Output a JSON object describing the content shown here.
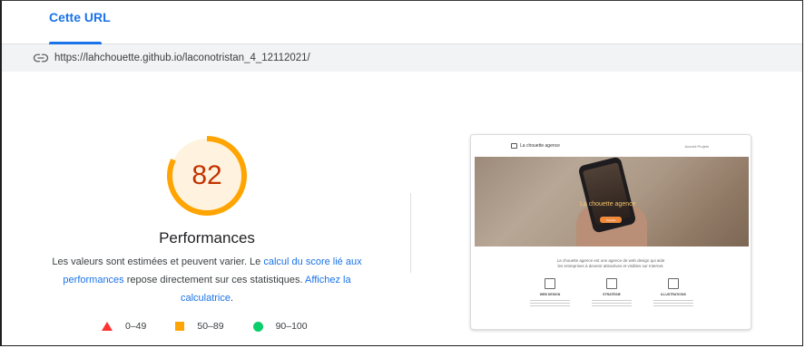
{
  "tabs": [
    {
      "label": "Cette URL",
      "active": true
    }
  ],
  "url": {
    "icon": "link-icon",
    "text": "https://lahchouette.github.io/laconotristan_4_12112021/"
  },
  "score": {
    "value": 82,
    "category": "Performances",
    "gauge_color": "#ffa400",
    "value_color": "#c33300",
    "fill_fraction": 0.82
  },
  "description": {
    "text_before": "Les valeurs sont estimées et peuvent varier. Le ",
    "link1": "calcul du score lié aux performances",
    "text_middle": " repose directement sur ces statistiques. ",
    "link2": "Affichez la calculatrice",
    "text_after": "."
  },
  "legend": [
    {
      "icon": "triangle-icon",
      "range": "0–49",
      "color": "#ff3333"
    },
    {
      "icon": "square-icon",
      "range": "50–89",
      "color": "#ffa400"
    },
    {
      "icon": "circle-icon",
      "range": "90–100",
      "color": "#0cce6b"
    }
  ],
  "screenshot": {
    "logo_text": "La chouette agence",
    "menu_text": "Accueil   Projets",
    "hero_title": "La chouette agence",
    "hero_button": "Contact",
    "tagline_1": "La chouette agence est une agence de web design qui aide",
    "tagline_2": "les entreprises à devenir attractives et visibles sur Internet.",
    "services": [
      {
        "icon": "web-design-icon",
        "title": "WEB DESIGN"
      },
      {
        "icon": "strategy-icon",
        "title": "STRATÉGIE"
      },
      {
        "icon": "illustration-icon",
        "title": "ILLUSTRATIONS"
      }
    ]
  }
}
